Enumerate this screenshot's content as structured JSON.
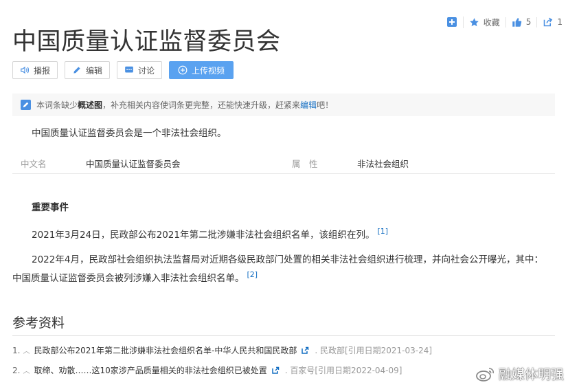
{
  "topbar": {
    "favorite_label": "收藏",
    "like_count": "5",
    "share_count": "1"
  },
  "title": "中国质量认证监督委员会",
  "toolbar": {
    "broadcast": "播报",
    "edit": "编辑",
    "discuss": "讨论",
    "upload_video": "上传视频"
  },
  "notice": {
    "prefix": "本词条缺少",
    "bold": "概述图",
    "middle": "，补充相关内容使词条更完整，还能快速升级，赶紧来",
    "link": "编辑",
    "suffix": "吧！"
  },
  "summary": "中国质量认证监督委员会是一个非法社会组织。",
  "basic_info": [
    {
      "name": "中文名",
      "value": "中国质量认证监督委员会"
    },
    {
      "name": "属　性",
      "value": "非法社会组织"
    }
  ],
  "events": {
    "heading": "重要事件",
    "paragraphs": [
      {
        "text": "2021年3月24日，民政部公布2021年第二批涉嫌非法社会组织名单，该组织在列。",
        "ref": "[1]"
      },
      {
        "text": "2022年4月，民政部社会组织执法监督局对近期各级民政部门处置的相关非法社会组织进行梳理，并向社会公开曝光，其中：中国质量认证监督委员会被列涉嫌入非法社会组织名单。",
        "ref": "[2]"
      }
    ]
  },
  "references": {
    "heading": "参考资料",
    "items": [
      {
        "num": "1.",
        "text": "民政部公布2021年第二批涉嫌非法社会组织名单-中华人民共和国民政部",
        "source": ". 民政部[引用日期2021-03-24]"
      },
      {
        "num": "2.",
        "text": "取缔、劝散……这10家涉产品质量相关的非法社会组织已被处置",
        "source": ". 百家号[引用日期2022-04-09]"
      }
    ]
  },
  "watermark": "融媒体明强",
  "colors": {
    "link": "#136ec2",
    "primary_button": "#5aa2f0",
    "icon_blue": "#4a90e2"
  }
}
